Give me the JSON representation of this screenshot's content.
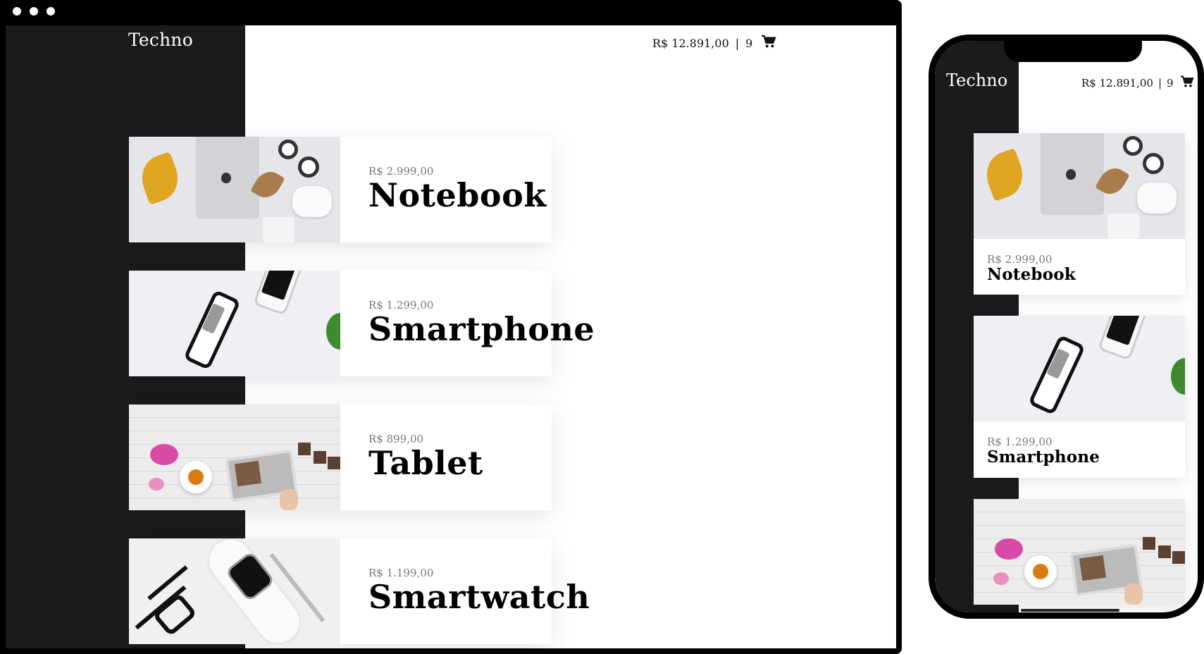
{
  "app": {
    "logo": "Techno"
  },
  "cart": {
    "total": "R$ 12.891,00",
    "separator": "|",
    "count": "9",
    "icon": "shopping-cart-icon"
  },
  "products": [
    {
      "name": "Notebook",
      "price": "R$ 2.999,00"
    },
    {
      "name": "Smartphone",
      "price": "R$ 1.299,00"
    },
    {
      "name": "Tablet",
      "price": "R$ 899,00"
    },
    {
      "name": "Smartwatch",
      "price": "R$ 1.199,00"
    }
  ],
  "colors": {
    "sidebar": "#1b1b1b",
    "frame": "#000000",
    "price": "#777777",
    "title": "#000000",
    "background": "#ffffff"
  }
}
